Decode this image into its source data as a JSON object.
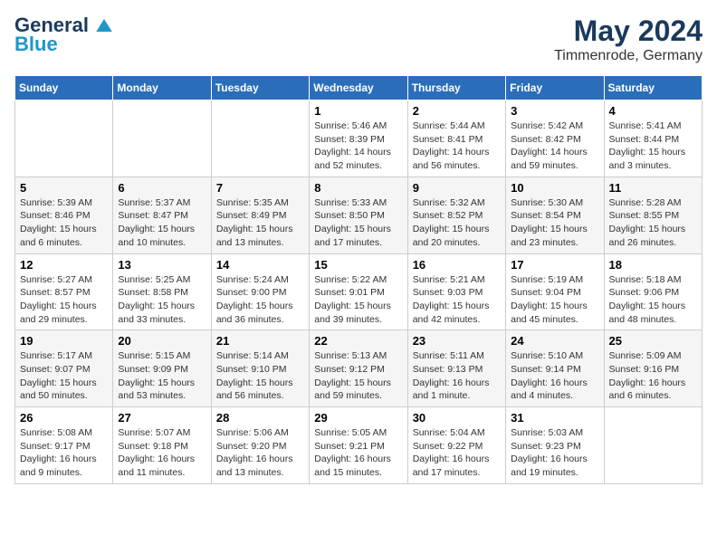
{
  "logo": {
    "line1": "General",
    "line2": "Blue"
  },
  "header": {
    "month": "May 2024",
    "location": "Timmenrode, Germany"
  },
  "weekdays": [
    "Sunday",
    "Monday",
    "Tuesday",
    "Wednesday",
    "Thursday",
    "Friday",
    "Saturday"
  ],
  "weeks": [
    [
      {
        "day": "",
        "info": ""
      },
      {
        "day": "",
        "info": ""
      },
      {
        "day": "",
        "info": ""
      },
      {
        "day": "1",
        "info": "Sunrise: 5:46 AM\nSunset: 8:39 PM\nDaylight: 14 hours\nand 52 minutes."
      },
      {
        "day": "2",
        "info": "Sunrise: 5:44 AM\nSunset: 8:41 PM\nDaylight: 14 hours\nand 56 minutes."
      },
      {
        "day": "3",
        "info": "Sunrise: 5:42 AM\nSunset: 8:42 PM\nDaylight: 14 hours\nand 59 minutes."
      },
      {
        "day": "4",
        "info": "Sunrise: 5:41 AM\nSunset: 8:44 PM\nDaylight: 15 hours\nand 3 minutes."
      }
    ],
    [
      {
        "day": "5",
        "info": "Sunrise: 5:39 AM\nSunset: 8:46 PM\nDaylight: 15 hours\nand 6 minutes."
      },
      {
        "day": "6",
        "info": "Sunrise: 5:37 AM\nSunset: 8:47 PM\nDaylight: 15 hours\nand 10 minutes."
      },
      {
        "day": "7",
        "info": "Sunrise: 5:35 AM\nSunset: 8:49 PM\nDaylight: 15 hours\nand 13 minutes."
      },
      {
        "day": "8",
        "info": "Sunrise: 5:33 AM\nSunset: 8:50 PM\nDaylight: 15 hours\nand 17 minutes."
      },
      {
        "day": "9",
        "info": "Sunrise: 5:32 AM\nSunset: 8:52 PM\nDaylight: 15 hours\nand 20 minutes."
      },
      {
        "day": "10",
        "info": "Sunrise: 5:30 AM\nSunset: 8:54 PM\nDaylight: 15 hours\nand 23 minutes."
      },
      {
        "day": "11",
        "info": "Sunrise: 5:28 AM\nSunset: 8:55 PM\nDaylight: 15 hours\nand 26 minutes."
      }
    ],
    [
      {
        "day": "12",
        "info": "Sunrise: 5:27 AM\nSunset: 8:57 PM\nDaylight: 15 hours\nand 29 minutes."
      },
      {
        "day": "13",
        "info": "Sunrise: 5:25 AM\nSunset: 8:58 PM\nDaylight: 15 hours\nand 33 minutes."
      },
      {
        "day": "14",
        "info": "Sunrise: 5:24 AM\nSunset: 9:00 PM\nDaylight: 15 hours\nand 36 minutes."
      },
      {
        "day": "15",
        "info": "Sunrise: 5:22 AM\nSunset: 9:01 PM\nDaylight: 15 hours\nand 39 minutes."
      },
      {
        "day": "16",
        "info": "Sunrise: 5:21 AM\nSunset: 9:03 PM\nDaylight: 15 hours\nand 42 minutes."
      },
      {
        "day": "17",
        "info": "Sunrise: 5:19 AM\nSunset: 9:04 PM\nDaylight: 15 hours\nand 45 minutes."
      },
      {
        "day": "18",
        "info": "Sunrise: 5:18 AM\nSunset: 9:06 PM\nDaylight: 15 hours\nand 48 minutes."
      }
    ],
    [
      {
        "day": "19",
        "info": "Sunrise: 5:17 AM\nSunset: 9:07 PM\nDaylight: 15 hours\nand 50 minutes."
      },
      {
        "day": "20",
        "info": "Sunrise: 5:15 AM\nSunset: 9:09 PM\nDaylight: 15 hours\nand 53 minutes."
      },
      {
        "day": "21",
        "info": "Sunrise: 5:14 AM\nSunset: 9:10 PM\nDaylight: 15 hours\nand 56 minutes."
      },
      {
        "day": "22",
        "info": "Sunrise: 5:13 AM\nSunset: 9:12 PM\nDaylight: 15 hours\nand 59 minutes."
      },
      {
        "day": "23",
        "info": "Sunrise: 5:11 AM\nSunset: 9:13 PM\nDaylight: 16 hours\nand 1 minute."
      },
      {
        "day": "24",
        "info": "Sunrise: 5:10 AM\nSunset: 9:14 PM\nDaylight: 16 hours\nand 4 minutes."
      },
      {
        "day": "25",
        "info": "Sunrise: 5:09 AM\nSunset: 9:16 PM\nDaylight: 16 hours\nand 6 minutes."
      }
    ],
    [
      {
        "day": "26",
        "info": "Sunrise: 5:08 AM\nSunset: 9:17 PM\nDaylight: 16 hours\nand 9 minutes."
      },
      {
        "day": "27",
        "info": "Sunrise: 5:07 AM\nSunset: 9:18 PM\nDaylight: 16 hours\nand 11 minutes."
      },
      {
        "day": "28",
        "info": "Sunrise: 5:06 AM\nSunset: 9:20 PM\nDaylight: 16 hours\nand 13 minutes."
      },
      {
        "day": "29",
        "info": "Sunrise: 5:05 AM\nSunset: 9:21 PM\nDaylight: 16 hours\nand 15 minutes."
      },
      {
        "day": "30",
        "info": "Sunrise: 5:04 AM\nSunset: 9:22 PM\nDaylight: 16 hours\nand 17 minutes."
      },
      {
        "day": "31",
        "info": "Sunrise: 5:03 AM\nSunset: 9:23 PM\nDaylight: 16 hours\nand 19 minutes."
      },
      {
        "day": "",
        "info": ""
      }
    ]
  ]
}
